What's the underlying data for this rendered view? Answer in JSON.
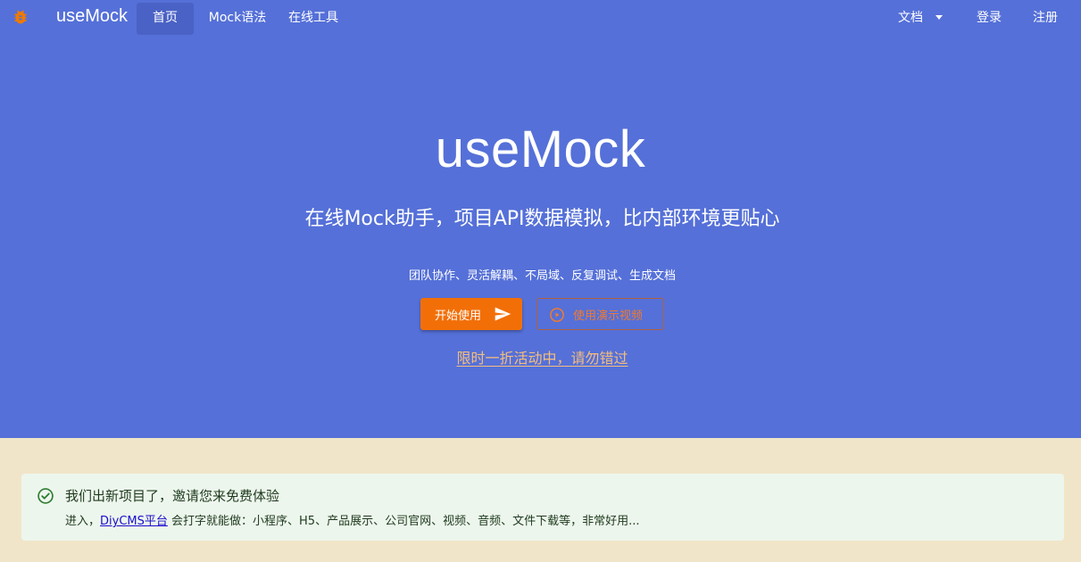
{
  "header": {
    "brand": "useMock",
    "nav": {
      "home": "首页",
      "mock_syntax": "Mock语法",
      "online_tools": "在线工具",
      "docs": "文档",
      "login": "登录",
      "register": "注册"
    }
  },
  "hero": {
    "title": "useMock",
    "subtitle": "在线Mock助手，项目API数据模拟，比内部环境更贴心",
    "tagline": "团队协作、灵活解耦、不局域、反复调试、生成文档",
    "start_button": "开始使用",
    "video_button": "使用演示视频",
    "promo": "限时一折活动中，请勿错过"
  },
  "notice": {
    "title": "我们出新项目了，邀请您来免费体验",
    "body_prefix": "进入，",
    "link_text": "DiyCMS平台",
    "body_suffix": " 会打字就能做：小程序、H5、产品展示、公司官网、视频、音频、文件下载等，非常好用..."
  },
  "colors": {
    "hero_bg": "#5570d8",
    "nav_active_bg": "#4a62c5",
    "start_button_bg": "#f26f08",
    "video_button_text": "#f07a30",
    "promo_text": "#f5bd7c",
    "bottom_bg": "#f1e5c9",
    "notice_bg": "#edf6ed",
    "notice_icon": "#2e7d32"
  },
  "icons": {
    "logo": "bug-icon",
    "docs_dropdown": "caret-down-icon",
    "start_button": "send-icon",
    "video_button": "play-circle-icon",
    "notice": "check-circle-icon"
  }
}
